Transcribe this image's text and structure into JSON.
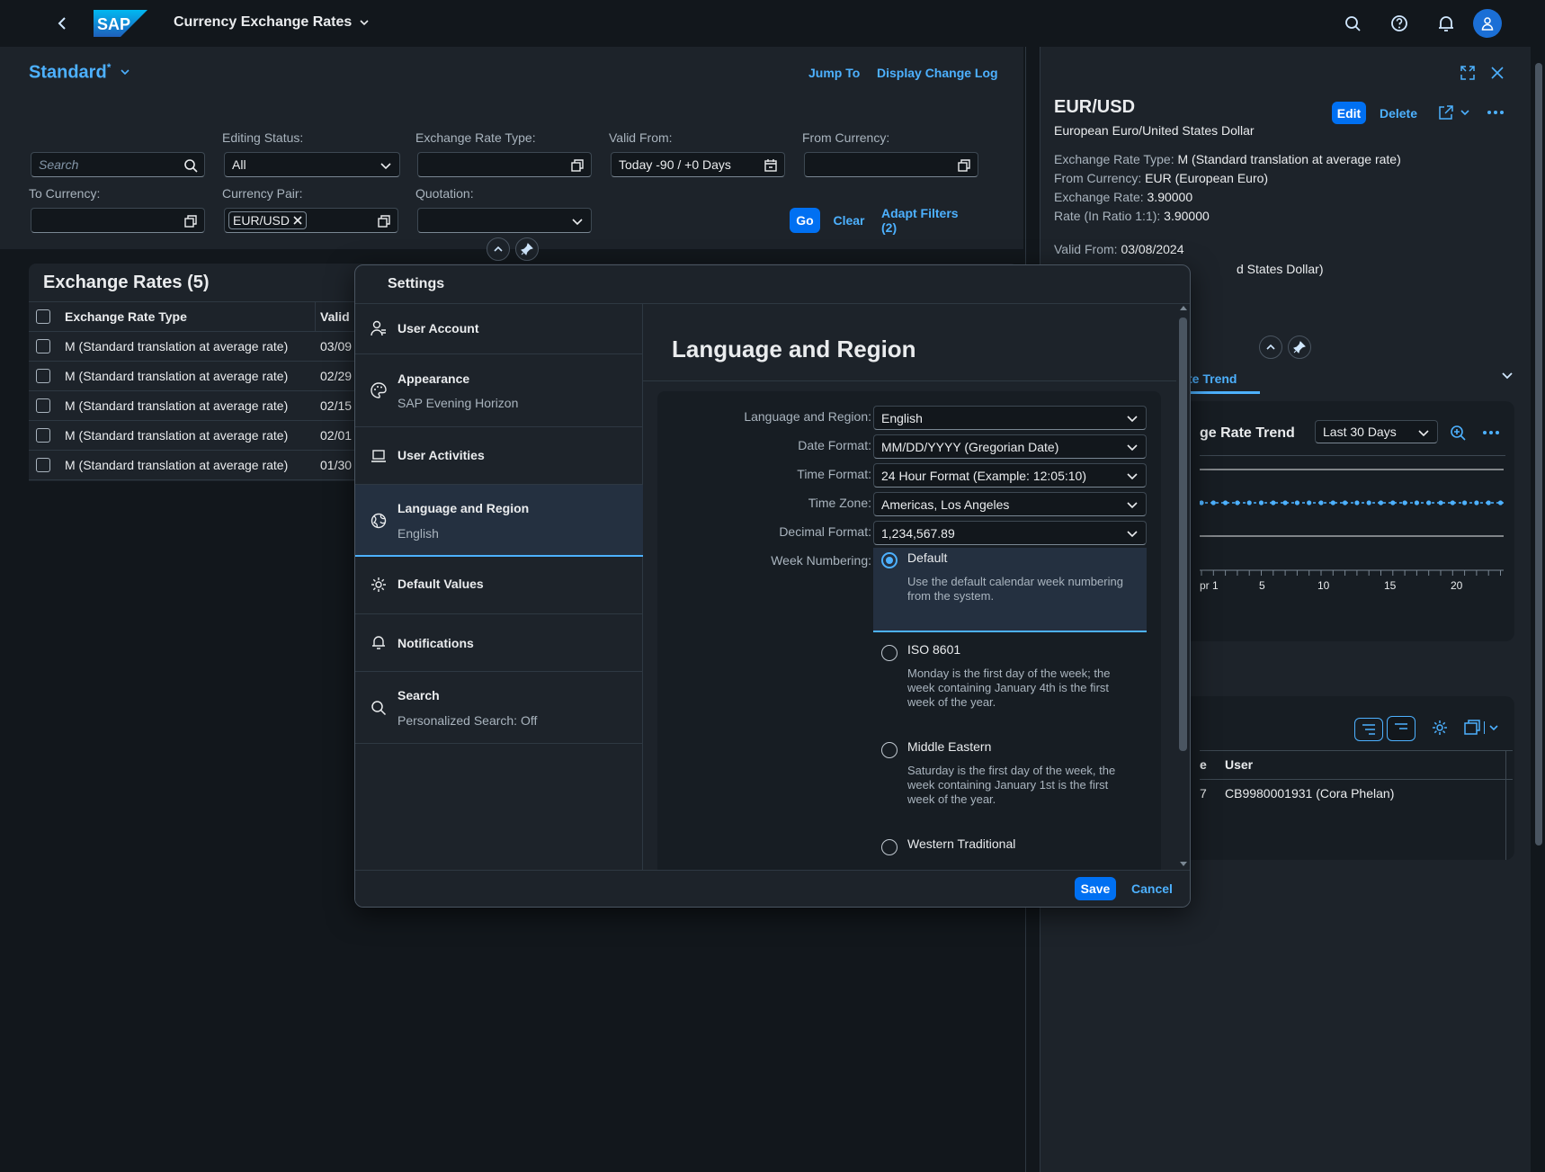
{
  "shell": {
    "app_title": "Currency Exchange Rates",
    "logo_text": "SAP"
  },
  "header": {
    "variant": "Standard",
    "variant_modified": "*",
    "jump_to": "Jump To",
    "change_log": "Display Change Log"
  },
  "filters": {
    "search_placeholder": "Search",
    "editing_status_label": "Editing Status:",
    "editing_status_value": "All",
    "rate_type_label": "Exchange Rate Type:",
    "valid_from_label": "Valid From:",
    "valid_from_value": "Today -90 / +0 Days",
    "from_currency_label": "From Currency:",
    "to_currency_label": "To Currency:",
    "currency_pair_label": "Currency Pair:",
    "currency_pair_token": "EUR/USD",
    "quotation_label": "Quotation:",
    "go": "Go",
    "clear": "Clear",
    "adapt": "Adapt Filters (2)"
  },
  "table": {
    "title": "Exchange Rates (5)",
    "columns": [
      "Exchange Rate Type",
      "Valid"
    ],
    "rows": [
      {
        "type": "M (Standard translation at average rate)",
        "valid": "03/09"
      },
      {
        "type": "M (Standard translation at average rate)",
        "valid": "02/29"
      },
      {
        "type": "M (Standard translation at average rate)",
        "valid": "02/15"
      },
      {
        "type": "M (Standard translation at average rate)",
        "valid": "02/01"
      },
      {
        "type": "M (Standard translation at average rate)",
        "valid": "01/30"
      }
    ]
  },
  "detail": {
    "title": "EUR/USD",
    "subtitle": "European Euro/United States Dollar",
    "edit": "Edit",
    "delete": "Delete",
    "attrs": [
      {
        "label": "Exchange Rate Type:",
        "value": "M (Standard translation at average rate)"
      },
      {
        "label": "From Currency:",
        "value": "EUR (European Euro)"
      },
      {
        "label": "Exchange Rate:",
        "value": "3.90000"
      },
      {
        "label": "Rate (In Ratio 1:1):",
        "value": "3.90000"
      }
    ],
    "valid_from_label": "Valid From:",
    "valid_from_value": "03/08/2024",
    "partial_to_currency": "d States Dollar)",
    "tab_partial": "te Trend",
    "trend_title_partial": "ge Rate Trend",
    "trend_range": "Last 30 Days",
    "axis_ticks": [
      "pr 1",
      "5",
      "10",
      "15",
      "20"
    ],
    "log_col_partial": "e",
    "log_col_user": "User",
    "log_row_partial": "7",
    "log_row_user": "CB9980001931 (Cora Phelan)"
  },
  "dialog": {
    "title": "Settings",
    "nav": [
      {
        "title": "User Account",
        "sub": "",
        "icon": "user-account-icon"
      },
      {
        "title": "Appearance",
        "sub": "SAP Evening Horizon",
        "icon": "palette-icon"
      },
      {
        "title": "User Activities",
        "sub": "",
        "icon": "laptop-icon"
      },
      {
        "title": "Language and Region",
        "sub": "English",
        "icon": "globe-icon"
      },
      {
        "title": "Default Values",
        "sub": "",
        "icon": "gear-icon"
      },
      {
        "title": "Notifications",
        "sub": "",
        "icon": "bell-icon"
      },
      {
        "title": "Search",
        "sub": "Personalized Search: Off",
        "icon": "search-icon"
      }
    ],
    "content_title": "Language and Region",
    "fields": [
      {
        "label": "Language and Region:",
        "value": "English"
      },
      {
        "label": "Date Format:",
        "value": "MM/DD/YYYY (Gregorian Date)"
      },
      {
        "label": "Time Format:",
        "value": "24 Hour Format (Example: 12:05:10)"
      },
      {
        "label": "Time Zone:",
        "value": "Americas, Los Angeles"
      },
      {
        "label": "Decimal Format:",
        "value": "1,234,567.89"
      }
    ],
    "week_label": "Week Numbering:",
    "week_options": [
      {
        "title": "Default",
        "desc": "Use the default calendar week numbering from the system.",
        "selected": true
      },
      {
        "title": "ISO 8601",
        "desc": "Monday is the first day of the week; the week containing January 4th is the first week of the year.",
        "selected": false
      },
      {
        "title": "Middle Eastern",
        "desc": "Saturday is the first day of the week, the week containing January 1st is the first week of the year.",
        "selected": false
      },
      {
        "title": "Western Traditional",
        "desc": "",
        "selected": false
      }
    ],
    "save": "Save",
    "cancel": "Cancel"
  },
  "colors": {
    "accent": "#4db1ff",
    "primary": "#0070f2",
    "bg": "#12171c",
    "surface": "#1d232a"
  }
}
